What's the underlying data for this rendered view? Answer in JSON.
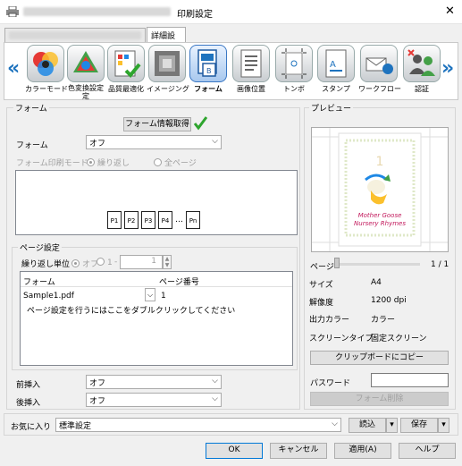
{
  "window": {
    "title": "印刷設定",
    "printer_name_blurred": "KONICA MINOLTA C368SeriesPCL6",
    "close": "✕"
  },
  "tabs": [
    {
      "label": "KONICA MINOLTA C368SeriesPCL6"
    },
    {
      "label": "詳細設定"
    }
  ],
  "toolbar": {
    "items": [
      {
        "label": "カラーモード",
        "icon": "color-mode-icon"
      },
      {
        "label": "色変換設定",
        "label2": "定",
        "icon": "color-conversion-icon"
      },
      {
        "label": "品質最適化",
        "icon": "quality-icon"
      },
      {
        "label": "イメージング",
        "icon": "imaging-icon"
      },
      {
        "label": "フォーム",
        "icon": "form-icon"
      },
      {
        "label": "画像位置",
        "icon": "image-position-icon"
      },
      {
        "label": "トンボ",
        "icon": "crop-marks-icon"
      },
      {
        "label": "スタンプ",
        "icon": "stamp-icon"
      },
      {
        "label": "ワークフロー",
        "icon": "workflow-icon"
      },
      {
        "label": "認証",
        "icon": "authentication-icon"
      }
    ],
    "left_arrow": "«",
    "right_arrow": "»"
  },
  "form_section": {
    "title": "フォーム",
    "get_info_button": "フォーム情報取得",
    "form_label": "フォーム",
    "form_value": "オフ",
    "print_mode_label": "フォーム印刷モード",
    "mode_repeat": "繰り返し",
    "mode_all": "全ページ",
    "pages": [
      "P1",
      "P2",
      "P3",
      "P4",
      "…",
      "Pn"
    ]
  },
  "page_settings": {
    "title": "ページ設定",
    "repeat_unit_label": "繰り返し単位",
    "opt_off": "オフ",
    "opt_one": "1",
    "dash": "-",
    "stepper_value": "1",
    "col_form": "フォーム",
    "col_page": "ページ番号",
    "row_form": "Sample1.pdf",
    "row_page": "1",
    "hint": "ページ設定を行うにはここをダブルクリックしてください"
  },
  "insert": {
    "front_label": "前挿入",
    "front_value": "オフ",
    "back_label": "後挿入",
    "back_value": "オフ"
  },
  "preview": {
    "title": "プレビュー",
    "page_label": "ページ",
    "page_value": "1 / 1",
    "size_label": "サイズ",
    "size_value": "A4",
    "resolution_label": "解像度",
    "resolution_value": "1200 dpi",
    "output_color_label": "出力カラー",
    "output_color_value": "カラー",
    "screen_label": "スクリーンタイプ",
    "screen_value": "固定スクリーン",
    "copy_button": "クリップボードにコピー",
    "password_label": "パスワード",
    "delete_button": "フォーム削除",
    "image_number": "1",
    "book_title1": "Mother Goose",
    "book_title2": "Nursery Rhymes"
  },
  "favorites": {
    "label": "お気に入り",
    "value": "標準設定",
    "load": "読込",
    "save": "保存"
  },
  "footer": {
    "ok": "OK",
    "cancel": "キャンセル",
    "apply": "適用(A)",
    "help": "ヘルプ"
  },
  "colors": {
    "accent": "#1e73be",
    "check": "#2ea52e",
    "book_title": "#c2185b"
  }
}
